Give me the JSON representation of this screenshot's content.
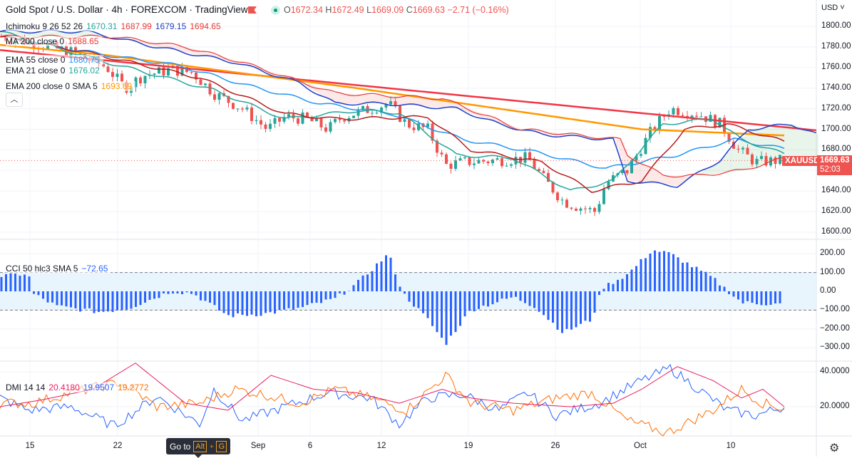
{
  "header": {
    "title": "Gold Spot / U.S. Dollar · 4h · FOREXCOM · TradingView",
    "ohlc": {
      "o_label": "O",
      "o": "1672.34",
      "h_label": "H",
      "h": "1672.49",
      "l_label": "L",
      "l": "1669.09",
      "c_label": "C",
      "c": "1669.63",
      "change": "−2.71 (−0.16%)"
    }
  },
  "legend": [
    {
      "name": "Ichimoku 9 26 52 26",
      "values": [
        {
          "v": "1670.31",
          "color": "#26a69a"
        },
        {
          "v": "1687.99",
          "color": "#e53935"
        },
        {
          "v": "1679.15",
          "color": "#1e40c8"
        },
        {
          "v": "1694.65",
          "color": "#e53935"
        }
      ]
    },
    {
      "name": "MA 200 close 0",
      "values": [
        {
          "v": "1688.65",
          "color": "#e53935"
        }
      ]
    },
    {
      "name": "EMA 55 close 0",
      "values": [
        {
          "v": "1680.75",
          "color": "#2196f3"
        }
      ]
    },
    {
      "name": "EMA 21 close 0",
      "values": [
        {
          "v": "1676.02",
          "color": "#26a69a"
        }
      ]
    },
    {
      "name": "EMA 200 close 0 SMA 5",
      "values": [
        {
          "v": "1693.69",
          "color": "#ff9800"
        }
      ]
    }
  ],
  "cci_legend": {
    "name": "CCI 50 hlc3 SMA 5",
    "value": "−72.65"
  },
  "dmi_legend": {
    "name": "DMI 14 14",
    "v1": "20.4180",
    "v2": "19.9507",
    "v3": "19.2772"
  },
  "price_axis": {
    "currency": "USD",
    "ticks": [
      "1800.00",
      "1780.00",
      "1760.00",
      "1740.00",
      "1720.00",
      "1700.00",
      "1680.00",
      "1660.00",
      "1640.00",
      "1620.00",
      "1600.00"
    ]
  },
  "cci_axis": {
    "ticks": [
      "200.00",
      "100.00",
      "0.00",
      "−100.00",
      "−200.00",
      "−300.00"
    ]
  },
  "dmi_axis": {
    "ticks": [
      "40.0000",
      "20.0000"
    ]
  },
  "time_axis": {
    "ticks": [
      "15",
      "22",
      "Sep",
      "6",
      "12",
      "19",
      "26",
      "Oct",
      "10"
    ]
  },
  "current": {
    "symbol": "XAUUSD",
    "price": "1669.63",
    "countdown": "52:03"
  },
  "goto": {
    "label": "Go to",
    "key1": "Alt",
    "plus": "+",
    "key2": "G"
  },
  "colors": {
    "up": "#26a69a",
    "down": "#ef5350",
    "cci": "#2962ff",
    "dmi_plus": "#2962ff",
    "dmi_minus": "#ff6d00",
    "adx": "#e91e63"
  },
  "chart_data": {
    "type": "candlestick",
    "title": "Gold Spot / U.S. Dollar 4h",
    "ylim": [
      1600,
      1800
    ],
    "close_path": [
      [
        0,
        1790
      ],
      [
        40,
        1785
      ],
      [
        100,
        1775
      ],
      [
        150,
        1760
      ],
      [
        175,
        1740
      ],
      [
        200,
        1752
      ],
      [
        240,
        1758
      ],
      [
        270,
        1755
      ],
      [
        300,
        1735
      ],
      [
        340,
        1720
      ],
      [
        375,
        1700
      ],
      [
        400,
        1712
      ],
      [
        430,
        1710
      ],
      [
        460,
        1700
      ],
      [
        480,
        1712
      ],
      [
        510,
        1718
      ],
      [
        545,
        1725
      ],
      [
        570,
        1705
      ],
      [
        600,
        1700
      ],
      [
        625,
        1665
      ],
      [
        650,
        1668
      ],
      [
        700,
        1670
      ],
      [
        740,
        1672
      ],
      [
        765,
        1650
      ],
      [
        790,
        1630
      ],
      [
        810,
        1625
      ],
      [
        835,
        1620
      ],
      [
        850,
        1648
      ],
      [
        880,
        1660
      ],
      [
        915,
        1700
      ],
      [
        940,
        1720
      ],
      [
        980,
        1715
      ],
      [
        1010,
        1705
      ],
      [
        1035,
        1680
      ],
      [
        1060,
        1668
      ],
      [
        1100,
        1670
      ]
    ],
    "lines": [
      {
        "name": "MA 200",
        "color": "#f23645",
        "width": 2.5,
        "points": [
          [
            0,
            1777
          ],
          [
            1145,
            1699
          ]
        ]
      },
      {
        "name": "EMA 200",
        "color": "#ff9800",
        "width": 2.5,
        "points": [
          [
            0,
            1782
          ],
          [
            150,
            1772
          ],
          [
            300,
            1758
          ],
          [
            500,
            1740
          ],
          [
            650,
            1725
          ],
          [
            800,
            1710
          ],
          [
            900,
            1700
          ],
          [
            1000,
            1697
          ],
          [
            1100,
            1694
          ]
        ]
      },
      {
        "name": "EMA 55",
        "color": "#2196f3",
        "width": 1.5,
        "points": [
          [
            0,
            1790
          ],
          [
            150,
            1772
          ],
          [
            250,
            1762
          ],
          [
            350,
            1742
          ],
          [
            450,
            1725
          ],
          [
            550,
            1715
          ],
          [
            650,
            1690
          ],
          [
            750,
            1678
          ],
          [
            850,
            1662
          ],
          [
            950,
            1675
          ],
          [
            1030,
            1690
          ],
          [
            1100,
            1681
          ]
        ]
      },
      {
        "name": "EMA 21",
        "color": "#26a69a",
        "width": 1.5,
        "points": [
          [
            0,
            1795
          ],
          [
            150,
            1765
          ],
          [
            300,
            1738
          ],
          [
            400,
            1710
          ],
          [
            500,
            1718
          ],
          [
            560,
            1716
          ],
          [
            640,
            1675
          ],
          [
            720,
            1672
          ],
          [
            800,
            1640
          ],
          [
            860,
            1650
          ],
          [
            930,
            1705
          ],
          [
            1000,
            1710
          ],
          [
            1040,
            1690
          ],
          [
            1100,
            1676
          ]
        ]
      },
      {
        "name": "Ichimoku base",
        "color": "#b71c1c",
        "width": 1.5,
        "points": [
          [
            0,
            1790
          ],
          [
            120,
            1775
          ],
          [
            280,
            1750
          ],
          [
            400,
            1715
          ],
          [
            470,
            1710
          ],
          [
            600,
            1712
          ],
          [
            660,
            1680
          ],
          [
            760,
            1668
          ],
          [
            830,
            1640
          ],
          [
            900,
            1650
          ],
          [
            960,
            1700
          ],
          [
            1020,
            1705
          ],
          [
            1100,
            1688
          ]
        ]
      },
      {
        "name": "Ichimoku span B",
        "color": "#1e40c8",
        "width": 1.5,
        "points": [
          [
            0,
            1795
          ],
          [
            120,
            1795
          ],
          [
            220,
            1780
          ],
          [
            330,
            1765
          ],
          [
            420,
            1745
          ],
          [
            470,
            1725
          ],
          [
            540,
            1725
          ],
          [
            640,
            1720
          ],
          [
            700,
            1705
          ],
          [
            760,
            1695
          ],
          [
            860,
            1690
          ],
          [
            880,
            1650
          ],
          [
            950,
            1645
          ],
          [
            1010,
            1670
          ],
          [
            1050,
            1700
          ],
          [
            1110,
            1705
          ],
          [
            1145,
            1695
          ]
        ]
      },
      {
        "name": "Ichimoku span A",
        "color": "#e53935",
        "width": 1.2,
        "points": [
          [
            0,
            1790
          ],
          [
            160,
            1790
          ],
          [
            260,
            1780
          ],
          [
            340,
            1765
          ],
          [
            470,
            1735
          ],
          [
            620,
            1730
          ],
          [
            730,
            1700
          ],
          [
            870,
            1690
          ],
          [
            880,
            1675
          ],
          [
            930,
            1655
          ],
          [
            980,
            1655
          ],
          [
            1040,
            1660
          ],
          [
            1100,
            1672
          ]
        ]
      }
    ],
    "cci": {
      "ylim": [
        -300,
        200
      ],
      "anchors": [
        [
          0,
          80
        ],
        [
          40,
          95
        ],
        [
          45,
          -10
        ],
        [
          80,
          -80
        ],
        [
          140,
          -110
        ],
        [
          180,
          -90
        ],
        [
          240,
          0
        ],
        [
          270,
          -10
        ],
        [
          320,
          -130
        ],
        [
          370,
          -120
        ],
        [
          420,
          -90
        ],
        [
          470,
          -40
        ],
        [
          500,
          40
        ],
        [
          545,
          200
        ],
        [
          565,
          -10
        ],
        [
          600,
          -150
        ],
        [
          625,
          -280
        ],
        [
          660,
          -100
        ],
        [
          720,
          -30
        ],
        [
          750,
          -80
        ],
        [
          790,
          -220
        ],
        [
          830,
          -150
        ],
        [
          845,
          20
        ],
        [
          880,
          90
        ],
        [
          915,
          220
        ],
        [
          940,
          200
        ],
        [
          1000,
          70
        ],
        [
          1040,
          -60
        ],
        [
          1100,
          -70
        ]
      ]
    },
    "dmi": {
      "ylim": [
        0,
        50
      ],
      "series": [
        {
          "name": "+DI",
          "color": "#2962ff",
          "anchors": [
            [
              0,
              25
            ],
            [
              40,
              18
            ],
            [
              100,
              20
            ],
            [
              160,
              9
            ],
            [
              220,
              26
            ],
            [
              280,
              10
            ],
            [
              300,
              30
            ],
            [
              340,
              12
            ],
            [
              400,
              20
            ],
            [
              460,
              28
            ],
            [
              520,
              25
            ],
            [
              560,
              10
            ],
            [
              600,
              25
            ],
            [
              650,
              27
            ],
            [
              700,
              18
            ],
            [
              740,
              28
            ],
            [
              780,
              15
            ],
            [
              840,
              22
            ],
            [
              900,
              35
            ],
            [
              940,
              42
            ],
            [
              980,
              30
            ],
            [
              1020,
              18
            ],
            [
              1060,
              15
            ],
            [
              1100,
              20
            ]
          ]
        },
        {
          "name": "-DI",
          "color": "#ff6d00",
          "anchors": [
            [
              0,
              22
            ],
            [
              45,
              22
            ],
            [
              100,
              28
            ],
            [
              170,
              34
            ],
            [
              220,
              20
            ],
            [
              280,
              22
            ],
            [
              330,
              30
            ],
            [
              370,
              27
            ],
            [
              420,
              22
            ],
            [
              470,
              30
            ],
            [
              520,
              25
            ],
            [
              570,
              18
            ],
            [
              625,
              38
            ],
            [
              660,
              22
            ],
            [
              720,
              18
            ],
            [
              780,
              25
            ],
            [
              830,
              28
            ],
            [
              880,
              12
            ],
            [
              935,
              5
            ],
            [
              1000,
              18
            ],
            [
              1040,
              30
            ],
            [
              1070,
              22
            ],
            [
              1100,
              19
            ]
          ]
        },
        {
          "name": "ADX",
          "color": "#e91e63",
          "anchors": [
            [
              0,
              20
            ],
            [
              60,
              24
            ],
            [
              130,
              30
            ],
            [
              190,
              45
            ],
            [
              260,
              22
            ],
            [
              320,
              18
            ],
            [
              380,
              38
            ],
            [
              440,
              30
            ],
            [
              500,
              28
            ],
            [
              560,
              22
            ],
            [
              620,
              30
            ],
            [
              660,
              25
            ],
            [
              720,
              22
            ],
            [
              800,
              20
            ],
            [
              860,
              22
            ],
            [
              900,
              30
            ],
            [
              950,
              43
            ],
            [
              1000,
              35
            ],
            [
              1040,
              25
            ],
            [
              1070,
              30
            ],
            [
              1100,
              20
            ]
          ]
        }
      ]
    }
  }
}
